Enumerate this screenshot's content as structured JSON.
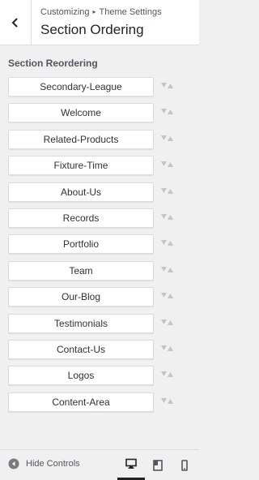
{
  "header": {
    "breadcrumb_root": "Customizing",
    "breadcrumb_sep": "▸",
    "breadcrumb_current": "Theme Settings",
    "title": "Section Ordering"
  },
  "section": {
    "label": "Section Reordering",
    "items": [
      {
        "label": "Secondary-League"
      },
      {
        "label": "Welcome"
      },
      {
        "label": "Related-Products"
      },
      {
        "label": "Fixture-Time"
      },
      {
        "label": "About-Us"
      },
      {
        "label": "Records"
      },
      {
        "label": "Portfolio"
      },
      {
        "label": "Team"
      },
      {
        "label": "Our-Blog"
      },
      {
        "label": "Testimonials"
      },
      {
        "label": "Contact-Us"
      },
      {
        "label": "Logos"
      },
      {
        "label": "Content-Area"
      }
    ]
  },
  "footer": {
    "hide_controls_label": "Hide Controls",
    "devices": [
      "desktop-icon",
      "tablet-icon",
      "mobile-icon"
    ],
    "active_device": "desktop"
  },
  "colors": {
    "background": "#f0f0f1",
    "panel": "#ffffff",
    "border": "#dcdcde",
    "arrow": "#c3c4c7"
  }
}
